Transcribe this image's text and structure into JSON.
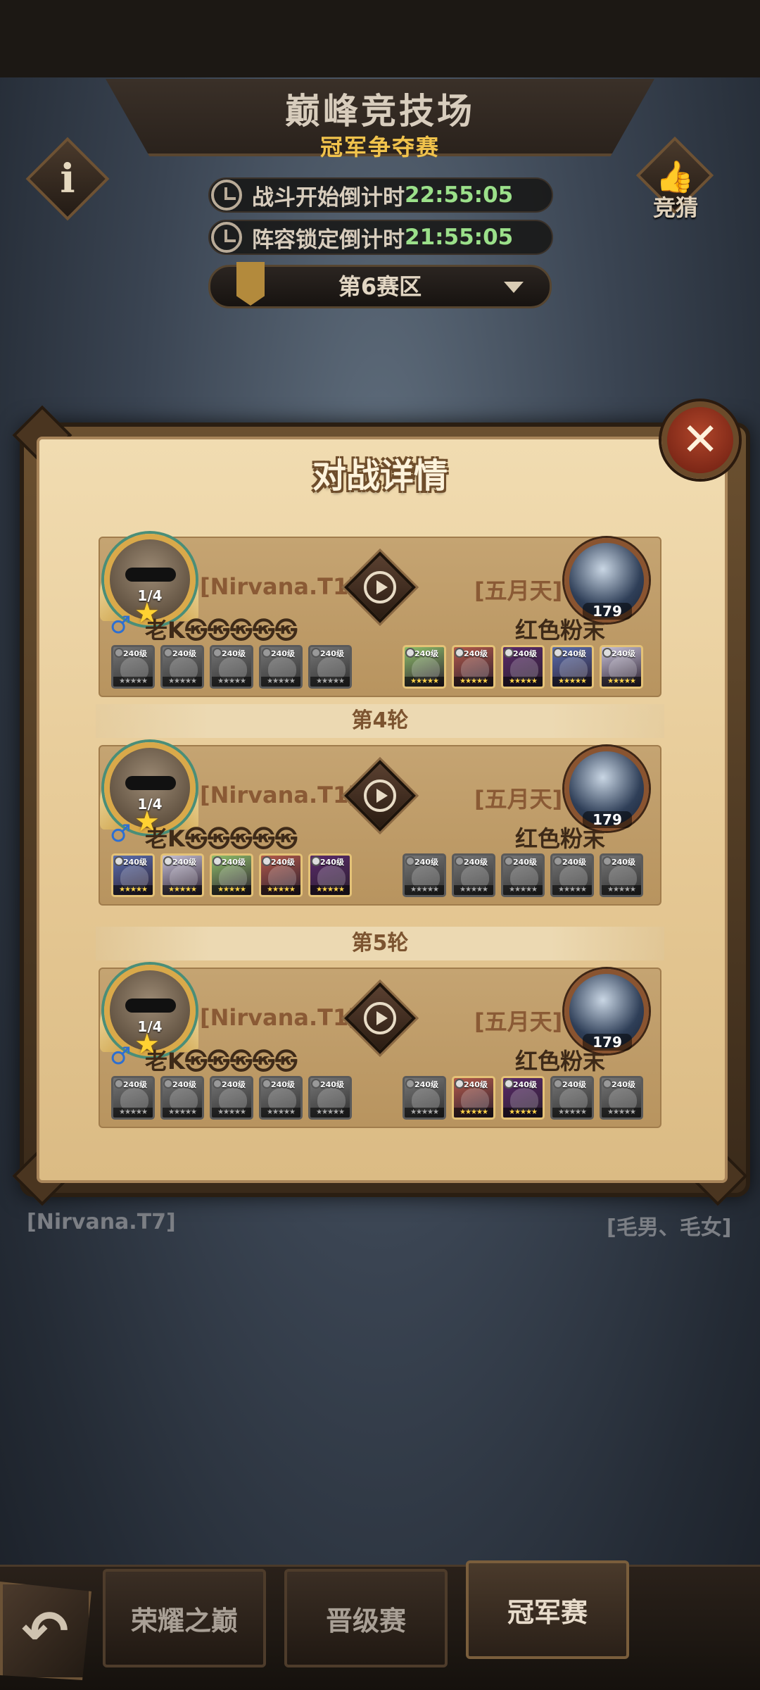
{
  "header": {
    "title": "巅峰竞技场",
    "subtitle": "冠军争夺赛",
    "guess_label": "竞猜",
    "info_glyph": "i",
    "timers": [
      {
        "label": "战斗开始倒计时",
        "value": "22:55:05"
      },
      {
        "label": "阵容锁定倒计时",
        "value": "21:55:05"
      }
    ],
    "zone_selector": "第6赛区"
  },
  "background": {
    "left_guild": "[Nirvana.T7]",
    "right_guild": "[毛男、毛女]"
  },
  "modal": {
    "title": "对战详情",
    "close_glyph": "✕",
    "matches": [
      {
        "round_label": "",
        "left": {
          "guild": "[Nirvana.T1]",
          "name": "老K㉿㉿㉿㉿㉿",
          "level": "1/4",
          "gender": "♂"
        },
        "right": {
          "guild": "[五月天]",
          "name": "红色粉末",
          "level": "179"
        },
        "left_heroes_state": "gray",
        "right_heroes_state": "color",
        "hero_level": "240级"
      },
      {
        "round_label": "第4轮",
        "left": {
          "guild": "[Nirvana.T1]",
          "name": "老K㉿㉿㉿㉿㉿",
          "level": "1/4",
          "gender": "♂"
        },
        "right": {
          "guild": "[五月天]",
          "name": "红色粉末",
          "level": "179"
        },
        "left_heroes_state": "color",
        "right_heroes_state": "gray",
        "hero_level": "240级"
      },
      {
        "round_label": "第5轮",
        "left": {
          "guild": "[Nirvana.T1]",
          "name": "老K㉿㉿㉿㉿㉿",
          "level": "1/4",
          "gender": "♂"
        },
        "right": {
          "guild": "[五月天]",
          "name": "红色粉末",
          "level": "179"
        },
        "left_heroes_state": "gray",
        "right_heroes_state": "mixed",
        "hero_level": "240级"
      }
    ]
  },
  "hero_colors": [
    "#5b6fb0",
    "#c7c2d8",
    "#8fbf6a",
    "#b35a4a",
    "#5a2a6a"
  ],
  "bottom_nav": {
    "tabs": [
      "荣耀之巅",
      "晋级赛",
      "冠军赛"
    ],
    "active_tab": "冠军赛"
  }
}
